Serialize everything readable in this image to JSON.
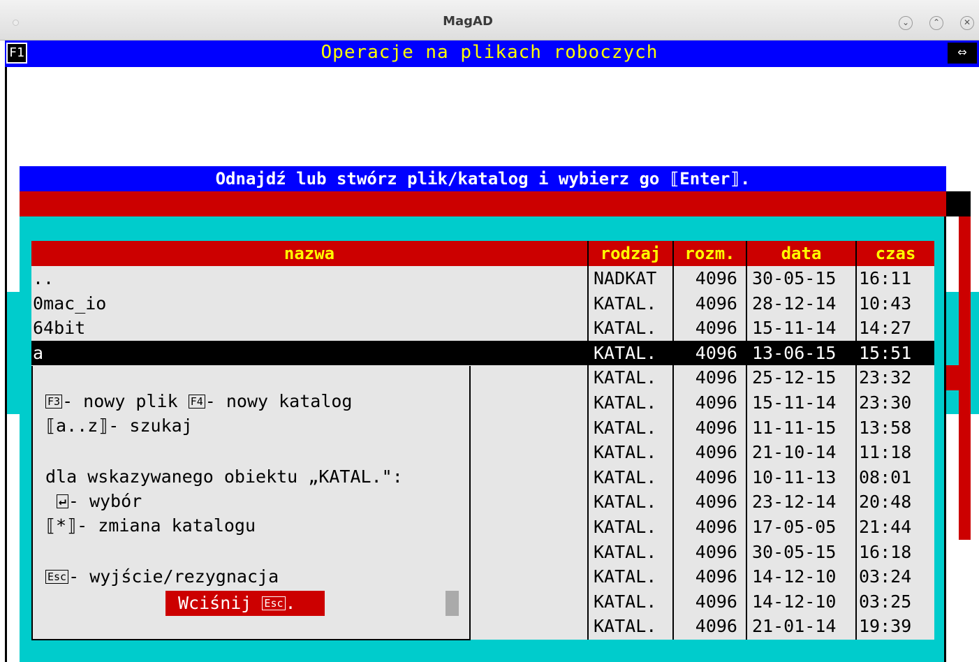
{
  "window": {
    "title": "MagAD",
    "controls": [
      "⌄",
      "⌃",
      "✕"
    ]
  },
  "header": {
    "f1_label": "F1",
    "title": "Operacje na plikach roboczych",
    "move_icon": "⇔"
  },
  "dialog": {
    "title": "Odnajdź lub stwórz plik/katalog i wybierz go ⟦Enter⟧.",
    "columns": [
      "nazwa",
      "rodzaj",
      "rozm.",
      "data",
      "czas"
    ],
    "rows": [
      {
        "name": "..",
        "kind": "NADKAT",
        "size": "4096",
        "date": "30-05-15",
        "time": "16:11"
      },
      {
        "name": "0mac_io",
        "kind": "KATAL.",
        "size": "4096",
        "date": "28-12-14",
        "time": "10:43"
      },
      {
        "name": "64bit",
        "kind": "KATAL.",
        "size": "4096",
        "date": "15-11-14",
        "time": "14:27"
      },
      {
        "name": "a",
        "kind": "KATAL.",
        "size": "4096",
        "date": "13-06-15",
        "time": "15:51",
        "selected": true
      },
      {
        "name": "",
        "kind": "KATAL.",
        "size": "4096",
        "date": "25-12-15",
        "time": "23:32"
      },
      {
        "name": "",
        "kind": "KATAL.",
        "size": "4096",
        "date": "15-11-14",
        "time": "23:30"
      },
      {
        "name": "",
        "kind": "KATAL.",
        "size": "4096",
        "date": "11-11-15",
        "time": "13:58"
      },
      {
        "name": "",
        "kind": "KATAL.",
        "size": "4096",
        "date": "21-10-14",
        "time": "11:18"
      },
      {
        "name": "",
        "kind": "KATAL.",
        "size": "4096",
        "date": "10-11-13",
        "time": "08:01"
      },
      {
        "name": "",
        "kind": "KATAL.",
        "size": "4096",
        "date": "23-12-14",
        "time": "20:48"
      },
      {
        "name": "",
        "kind": "KATAL.",
        "size": "4096",
        "date": "17-05-05",
        "time": "21:44"
      },
      {
        "name": "",
        "kind": "KATAL.",
        "size": "4096",
        "date": "30-05-15",
        "time": "16:18"
      },
      {
        "name": "",
        "kind": "KATAL.",
        "size": "4096",
        "date": "14-12-10",
        "time": "03:24"
      },
      {
        "name": "",
        "kind": "KATAL.",
        "size": "4096",
        "date": "14-12-10",
        "time": "03:25"
      },
      {
        "name": "",
        "kind": "KATAL.",
        "size": "4096",
        "date": "21-01-14",
        "time": "19:39"
      }
    ]
  },
  "help": {
    "f3_key": "F3",
    "f3_text": "- nowy plik ",
    "f4_key": "F4",
    "f4_text": "- nowy katalog",
    "search": "⟦a..z⟧- szukaj",
    "context": "dla wskazywanego obiektu „KATAL.\":",
    "enter_key": "↵",
    "enter_text": "- wybór",
    "star": "⟦*⟧- zmiana katalogu",
    "esc_key": "Esc",
    "esc_text": "- wyjście/rezygnacja",
    "press_text": "Wciśnij ",
    "press_key": "Esc",
    "press_end": "."
  },
  "colors": {
    "header_blue": "#0000ff",
    "accent_red": "#cc0000",
    "panel_cyan": "#00cccc",
    "header_text_yellow": "#ffff00"
  }
}
